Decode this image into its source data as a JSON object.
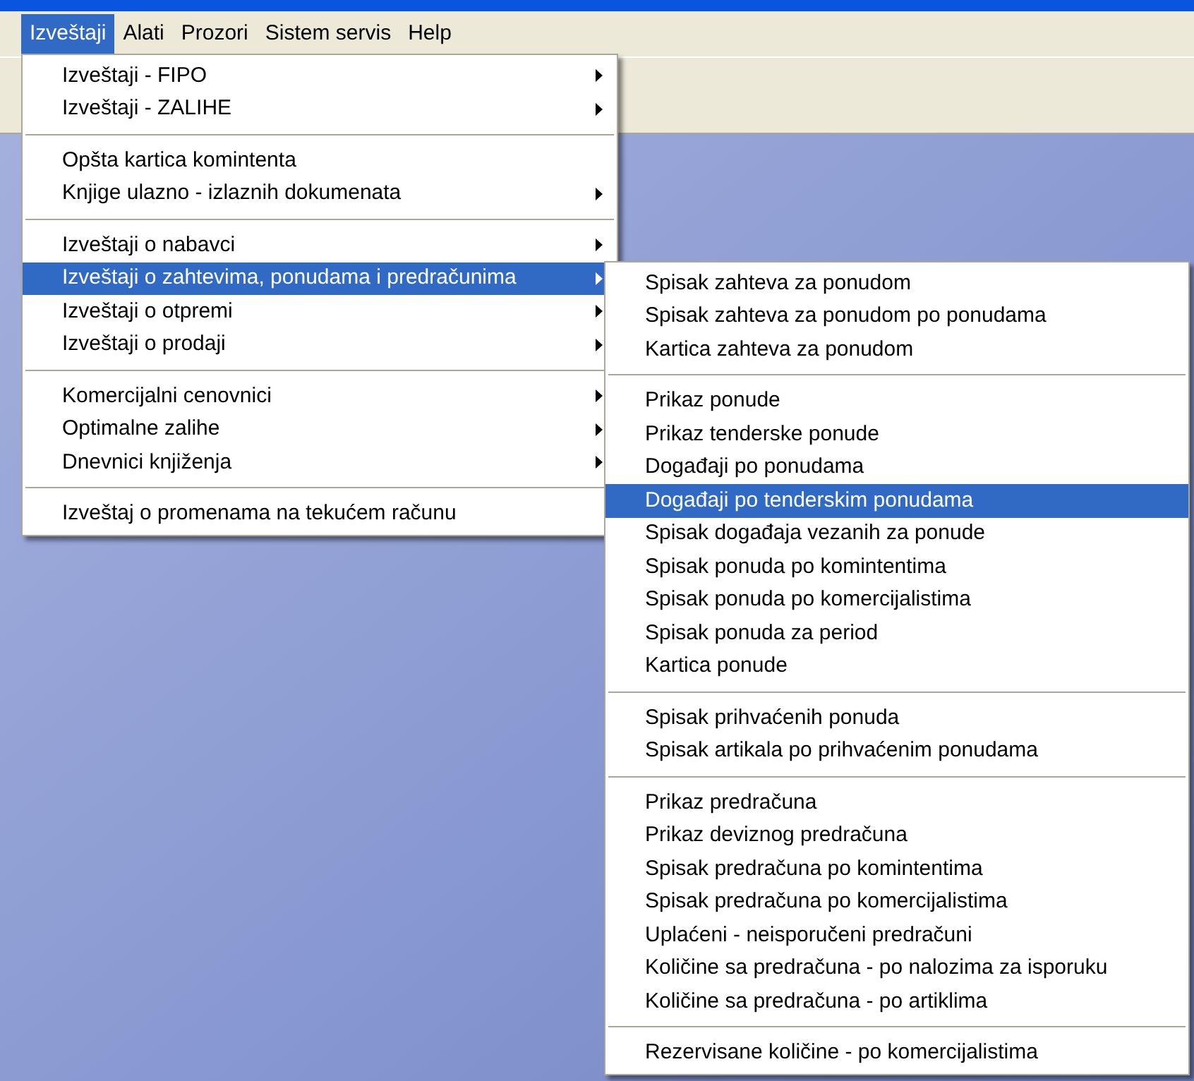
{
  "menubar": [
    {
      "label": "Izveštaji",
      "selected": true
    },
    {
      "label": "Alati",
      "selected": false
    },
    {
      "label": "Prozori",
      "selected": false
    },
    {
      "label": "Sistem servis",
      "selected": false
    },
    {
      "label": "Help",
      "selected": false
    }
  ],
  "menu": {
    "groups": [
      [
        {
          "label": "Izveštaji - FIPO",
          "submenu": true,
          "selected": false
        },
        {
          "label": "Izveštaji - ZALIHE",
          "submenu": true,
          "selected": false
        }
      ],
      [
        {
          "label": "Opšta kartica komintenta",
          "submenu": false,
          "selected": false
        },
        {
          "label": "Knjige ulazno - izlaznih dokumenata",
          "submenu": true,
          "selected": false
        }
      ],
      [
        {
          "label": "Izveštaji o nabavci",
          "submenu": true,
          "selected": false
        },
        {
          "label": "Izveštaji o zahtevima, ponudama i predračunima",
          "submenu": true,
          "selected": true
        },
        {
          "label": "Izveštaji o otpremi",
          "submenu": true,
          "selected": false
        },
        {
          "label": "Izveštaji o prodaji",
          "submenu": true,
          "selected": false
        }
      ],
      [
        {
          "label": "Komercijalni cenovnici",
          "submenu": true,
          "selected": false
        },
        {
          "label": "Optimalne zalihe",
          "submenu": true,
          "selected": false
        },
        {
          "label": "Dnevnici knjiženja",
          "submenu": true,
          "selected": false
        }
      ],
      [
        {
          "label": "Izveštaj o promenama na tekućem računu",
          "submenu": false,
          "selected": false
        }
      ]
    ]
  },
  "submenu": {
    "groups": [
      [
        {
          "label": "Spisak zahteva za ponudom",
          "submenu": false,
          "selected": false
        },
        {
          "label": "Spisak zahteva za ponudom po ponudama",
          "submenu": false,
          "selected": false
        },
        {
          "label": "Kartica zahteva za ponudom",
          "submenu": false,
          "selected": false
        }
      ],
      [
        {
          "label": "Prikaz ponude",
          "submenu": false,
          "selected": false
        },
        {
          "label": "Prikaz tenderske ponude",
          "submenu": false,
          "selected": false
        },
        {
          "label": "Događaji po ponudama",
          "submenu": false,
          "selected": false
        },
        {
          "label": "Događaji po tenderskim ponudama",
          "submenu": false,
          "selected": true
        },
        {
          "label": "Spisak događaja vezanih za ponude",
          "submenu": false,
          "selected": false
        },
        {
          "label": "Spisak ponuda po komintentima",
          "submenu": false,
          "selected": false
        },
        {
          "label": "Spisak ponuda po komercijalistima",
          "submenu": false,
          "selected": false
        },
        {
          "label": "Spisak ponuda za period",
          "submenu": false,
          "selected": false
        },
        {
          "label": "Kartica ponude",
          "submenu": false,
          "selected": false
        }
      ],
      [
        {
          "label": "Spisak prihvaćenih ponuda",
          "submenu": false,
          "selected": false
        },
        {
          "label": "Spisak artikala po prihvaćenim ponudama",
          "submenu": false,
          "selected": false
        }
      ],
      [
        {
          "label": "Prikaz predračuna",
          "submenu": false,
          "selected": false
        },
        {
          "label": "Prikaz deviznog predračuna",
          "submenu": false,
          "selected": false
        },
        {
          "label": "Spisak predračuna po komintentima",
          "submenu": false,
          "selected": false
        },
        {
          "label": "Spisak predračuna po komercijalistima",
          "submenu": false,
          "selected": false
        },
        {
          "label": "Uplaćeni - neisporučeni predračuni",
          "submenu": false,
          "selected": false
        },
        {
          "label": "Količine sa predračuna - po nalozima za isporuku",
          "submenu": false,
          "selected": false
        },
        {
          "label": "Količine sa predračuna - po artiklima",
          "submenu": false,
          "selected": false
        }
      ],
      [
        {
          "label": "Rezervisane količine - po komercijalistima",
          "submenu": false,
          "selected": false
        }
      ]
    ]
  }
}
